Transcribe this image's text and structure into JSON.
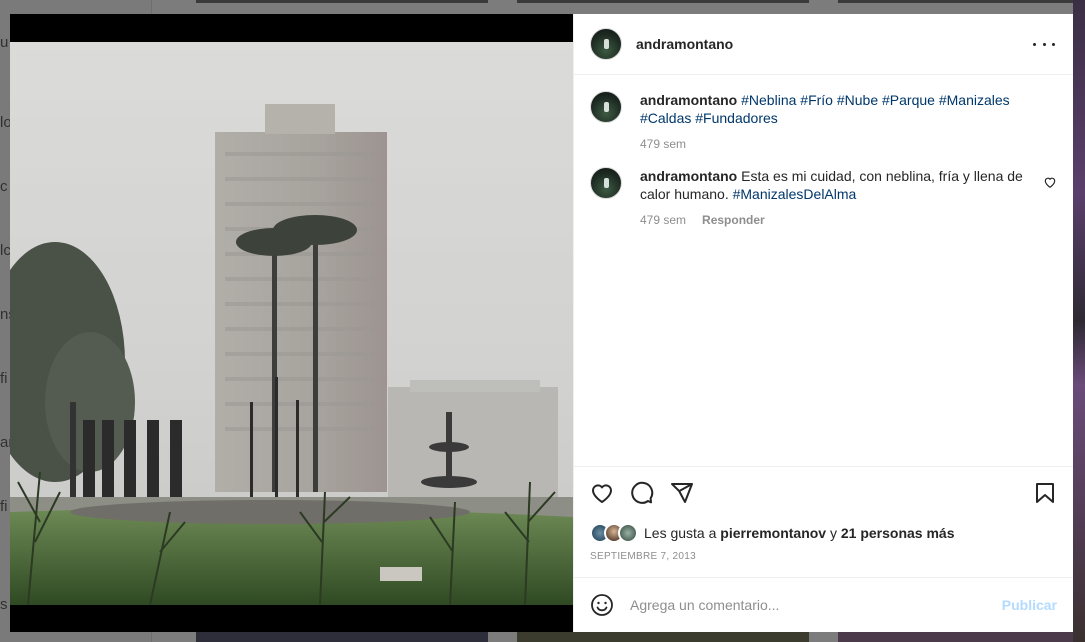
{
  "background": {
    "sidebar_fragments": [
      "u",
      "lo",
      "c",
      "lc",
      "ns",
      "fi",
      "ar",
      "fi",
      "s"
    ]
  },
  "post": {
    "author": "andramontano",
    "more_icon": "more-horizontal-icon",
    "image_alt": "Foggy city square with tall building, palm trees, fountain and monument pillars",
    "comments": [
      {
        "user": "andramontano",
        "text_parts": [
          {
            "t": "#Neblina",
            "tag": true
          },
          {
            "t": " ",
            "tag": false
          },
          {
            "t": "#Frío",
            "tag": true
          },
          {
            "t": " ",
            "tag": false
          },
          {
            "t": "#Nube",
            "tag": true
          },
          {
            "t": " ",
            "tag": false
          },
          {
            "t": "#Parque",
            "tag": true
          },
          {
            "t": " ",
            "tag": false
          },
          {
            "t": "#Manizales",
            "tag": true
          },
          {
            "t": " ",
            "tag": false
          },
          {
            "t": "#Caldas",
            "tag": true
          },
          {
            "t": " ",
            "tag": false
          },
          {
            "t": "#Fundadores",
            "tag": true
          }
        ],
        "time": "479 sem",
        "reply": ""
      },
      {
        "user": "andramontano",
        "text_parts": [
          {
            "t": "Esta es mi cuidad, con neblina, fría y llena de calor humano. ",
            "tag": false
          },
          {
            "t": "#ManizalesDelAlma",
            "tag": true
          }
        ],
        "time": "479 sem",
        "reply": "Responder"
      }
    ],
    "likes": {
      "prefix": "Les gusta a",
      "first_user": "pierremontanov",
      "connector": "y",
      "others": "21 personas más"
    },
    "date": "SEPTIEMBRE 7, 2013",
    "comment_input": {
      "placeholder": "Agrega un comentario...",
      "value": ""
    },
    "publish_label": "Publicar"
  },
  "colors": {
    "hashtag": "#00376b",
    "publish_disabled": "#b3dbff",
    "secondary_text": "#8e8e8e"
  }
}
